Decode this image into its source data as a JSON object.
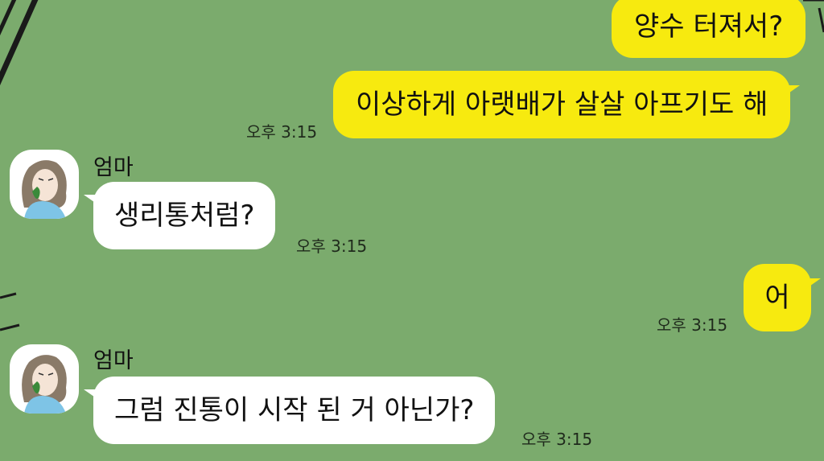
{
  "chat": {
    "contact_name": "엄마",
    "messages": [
      {
        "text": "양수 터져서?",
        "time": ""
      },
      {
        "text": "이상하게 아랫배가 살살 아프기도 해",
        "time": "오후 3:15"
      },
      {
        "sender": "엄마",
        "text": "생리통처럼?",
        "time": "오후 3:15"
      },
      {
        "text": "어",
        "time": "오후 3:15"
      },
      {
        "sender": "엄마",
        "text": "그럼 진통이 시작 된 거 아닌가?",
        "time": "오후 3:15"
      }
    ]
  },
  "colors": {
    "background": "#7bab6d",
    "outgoing_bubble": "#f7ea0f",
    "incoming_bubble": "#ffffff"
  },
  "icons": {
    "avatar": "woman-with-mask-avatar-icon"
  }
}
